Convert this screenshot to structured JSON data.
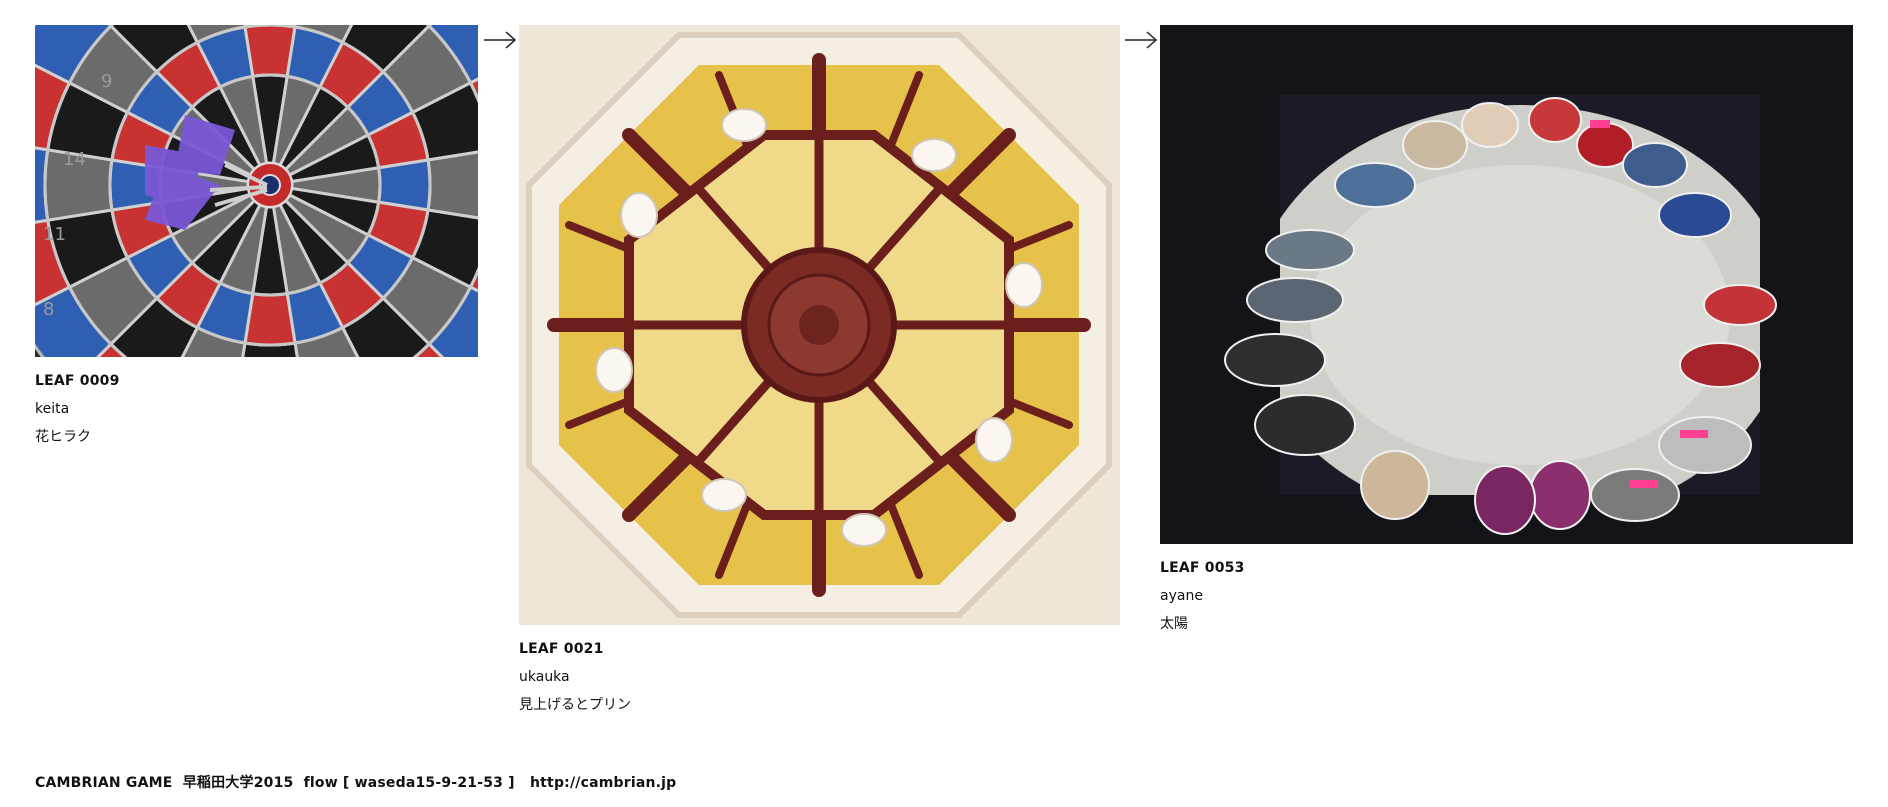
{
  "leaves": [
    {
      "id": "LEAF 0009",
      "author": "keita",
      "title": "花ヒラク",
      "photo": "dartboard-with-purple-darts"
    },
    {
      "id": "LEAF 0021",
      "author": "ukauka",
      "title": "見上げるとプリン",
      "photo": "ornate-yellow-dome-ceiling"
    },
    {
      "id": "LEAF 0053",
      "author": "ayane",
      "title": "太陽",
      "photo": "circle-of-sneakers"
    }
  ],
  "arrows": [
    "right-arrow-icon",
    "right-arrow-icon"
  ],
  "footer": {
    "text": "CAMBRIAN GAME  早稲田大学2015  flow [ waseda15-9-21-53 ]   http://cambrian.jp"
  }
}
